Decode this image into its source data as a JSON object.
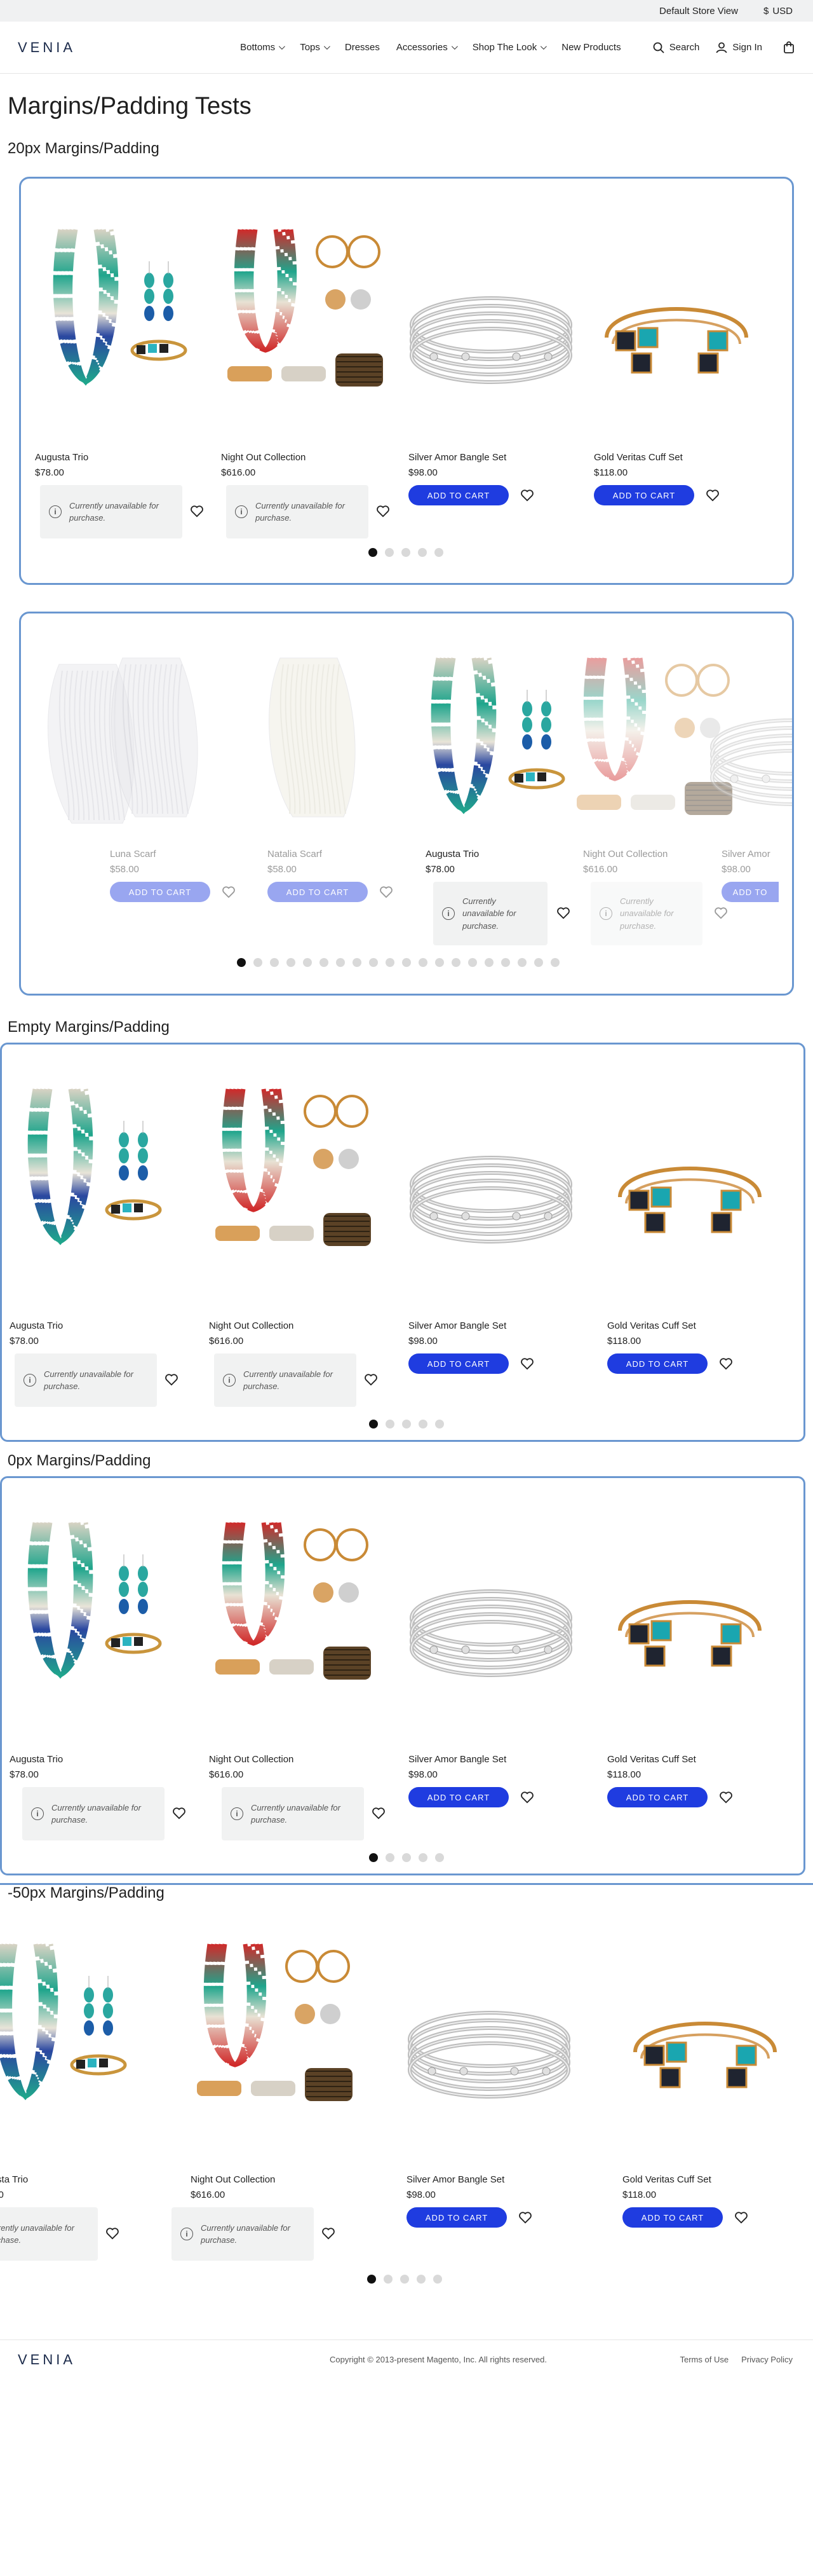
{
  "topbar": {
    "store": "Default Store View",
    "currency_symbol": "$",
    "currency": "USD"
  },
  "header": {
    "logo": "VENIA",
    "nav": [
      {
        "label": "Bottoms",
        "has_menu": true
      },
      {
        "label": "Tops",
        "has_menu": true
      },
      {
        "label": "Dresses",
        "has_menu": false
      },
      {
        "label": "Accessories",
        "has_menu": true
      },
      {
        "label": "Shop The Look",
        "has_menu": true
      },
      {
        "label": "New Products",
        "has_menu": false
      }
    ],
    "search_label": "Search",
    "signin_label": "Sign In"
  },
  "page_title": "Margins/Padding Tests",
  "sections": [
    {
      "title": "20px Margins/Padding"
    },
    {
      "title": "Empty Margins/Padding"
    },
    {
      "title": "0px Margins/Padding"
    },
    {
      "title": "-50px Margins/Padding"
    }
  ],
  "products": [
    {
      "name": "Augusta Trio",
      "price": "$78.00",
      "status": "unavailable"
    },
    {
      "name": "Night Out Collection",
      "price": "$616.00",
      "status": "unavailable"
    },
    {
      "name": "Silver Amor Bangle Set",
      "price": "$98.00",
      "status": "available"
    },
    {
      "name": "Gold Veritas Cuff Set",
      "price": "$118.00",
      "status": "available"
    }
  ],
  "carousel2_products": [
    {
      "name": "Luna Scarf",
      "price": "$58.00"
    },
    {
      "name": "Natalia Scarf",
      "price": "$58.00"
    },
    {
      "name": "Augusta Trio",
      "price": "$78.00"
    },
    {
      "name": "Night Out Collection",
      "price": "$616.00"
    },
    {
      "name": "Silver Amor",
      "price": "$98.00"
    }
  ],
  "unavailable_text": "Currently unavailable for purchase.",
  "add_to_cart": "ADD TO CART",
  "add_to_cart_truncated": "ADD TO",
  "footer": {
    "logo": "VENIA",
    "copyright": "Copyright © 2013-present Magento, Inc. All rights reserved.",
    "links": [
      "Terms of Use",
      "Privacy Policy"
    ]
  },
  "colors": {
    "accent": "#1f3ce0",
    "frame": "#6a97d0",
    "topbar": "#f0f1f2"
  }
}
